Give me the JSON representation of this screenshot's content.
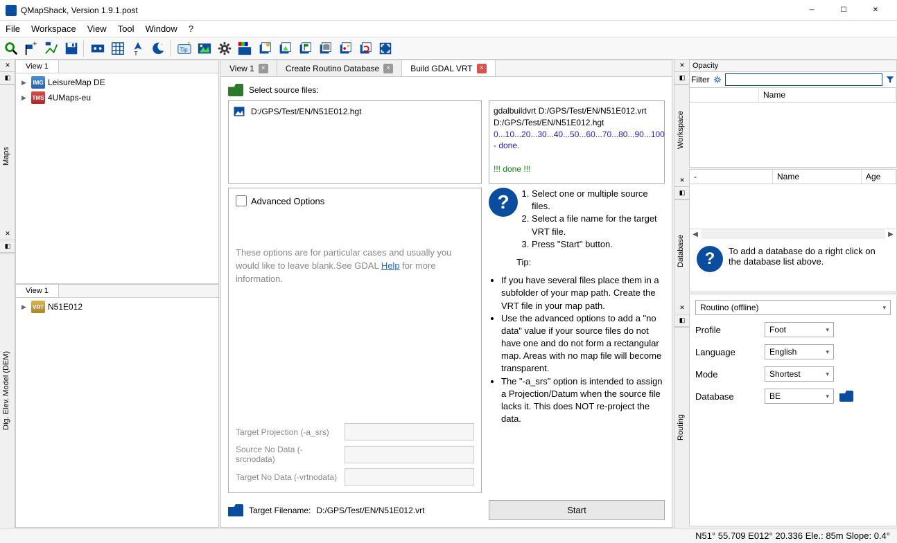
{
  "window": {
    "title": "QMapShack, Version 1.9.1.post"
  },
  "menubar": [
    "File",
    "Workspace",
    "View",
    "Tool",
    "Window",
    "?"
  ],
  "left": {
    "maps": {
      "tab": "View 1",
      "items": [
        {
          "label": "LeisureMap  DE",
          "icon": "IMG"
        },
        {
          "label": "4UMaps-eu",
          "icon": "TMS"
        }
      ]
    },
    "dem": {
      "tab": "View 1",
      "items": [
        {
          "label": "N51E012",
          "icon": "VRT"
        }
      ]
    },
    "tab_maps": "Maps",
    "tab_dem": "Dig. Elev. Model (DEM)"
  },
  "center": {
    "tabs": [
      {
        "label": "View 1",
        "closable": true,
        "active": false
      },
      {
        "label": "Create Routino Database",
        "closable": true,
        "active": false
      },
      {
        "label": "Build GDAL VRT",
        "closable": true,
        "active": true,
        "red": true
      }
    ],
    "select_src": "Select source files:",
    "src_file": "D:/GPS/Test/EN/N51E012.hgt",
    "output": {
      "cmd1": "gdalbuildvrt D:/GPS/Test/EN/N51E012.vrt D:/GPS/Test/EN/N51E012.hgt",
      "progress": "0...10...20...30...40...50...60...70...80...90...100 - done.",
      "done": "!!! done !!!"
    },
    "adv_label": "Advanced Options",
    "adv_text_pre": "These options are for particular cases and usually you would like to leave blank.See GDAL ",
    "adv_help": "Help",
    "adv_text_post": " for more information.",
    "adv_fields": {
      "proj": "Target Projection (-a_srs)",
      "srcno": "Source No Data (-srcnodata)",
      "vrtno": "Target No Data (-vrtnodata)"
    },
    "help_ol": [
      "Select one or multiple source files.",
      "Select a file name for the target VRT file.",
      "Press \"Start\" button."
    ],
    "tip_label": "Tip:",
    "help_ul": [
      "If you have several files place them in a subfolder of your map path. Create the VRT file in your map path.",
      "Use the advanced options to add a \"no data\" value if your source files do not have one and do not form a rectangular map. Areas with no map file will become transparent.",
      "The \"-a_srs\" option is intended to assign a Projection/Datum when the source file lacks it. This does NOT re-project the data."
    ],
    "target_label": "Target Filename:",
    "target_file": "D:/GPS/Test/EN/N51E012.vrt",
    "start": "Start"
  },
  "right": {
    "opacity": "Opacity",
    "filter": "Filter",
    "ws_cols": [
      "",
      "Name"
    ],
    "db_cols": [
      "-",
      "Name",
      "Age"
    ],
    "db_hint": "To add a database do a right click on the database list above.",
    "routing_sel": "Routino (offline)",
    "profile_l": "Profile",
    "profile_v": "Foot",
    "lang_l": "Language",
    "lang_v": "English",
    "mode_l": "Mode",
    "mode_v": "Shortest",
    "db_l": "Database",
    "db_v": "BE",
    "vtab_ws": "Workspace",
    "vtab_db": "Database",
    "vtab_rt": "Routing"
  },
  "statusbar": "N51° 55.709 E012° 20.336  Ele.: 85m  Slope: 0.4°"
}
